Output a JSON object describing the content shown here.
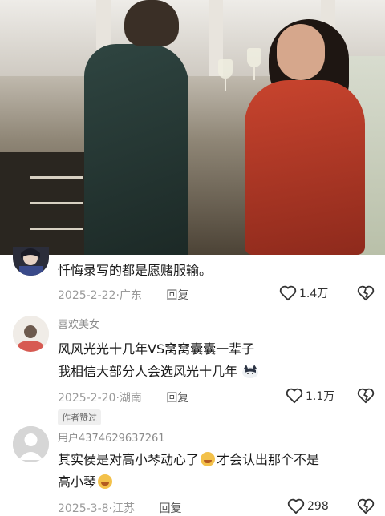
{
  "comments": [
    {
      "name": "",
      "text": "忏悔录写的都是愿赌服输。",
      "date": "2025-2-22",
      "region": "广东",
      "reply": "回复",
      "likes": "1.4万"
    },
    {
      "name": "喜欢美女",
      "line1": "风风光光十几年VS窝窝囊囊一辈子",
      "line2": "我相信大部分人会选风光十几年",
      "date": "2025-2-20",
      "region": "湖南",
      "reply": "回复",
      "likes": "1.1万",
      "badge": "作者赞过"
    },
    {
      "name": "用户4374629637261",
      "line1a": "其实侯是对高小琴动心了",
      "line1b": "才会认出那个不是",
      "line2": "高小琴",
      "date": "2025-3-8",
      "region": "江苏",
      "reply": "回复",
      "likes": "298"
    }
  ],
  "separator": "·",
  "colors": {
    "text": "#1a1a1a",
    "meta": "#9a9a9a",
    "name": "#8a8a8a"
  },
  "icons": [
    "heart-outline-icon",
    "broken-heart-icon",
    "laughing-crying-emoji-icon",
    "dog-emoji-icon"
  ]
}
